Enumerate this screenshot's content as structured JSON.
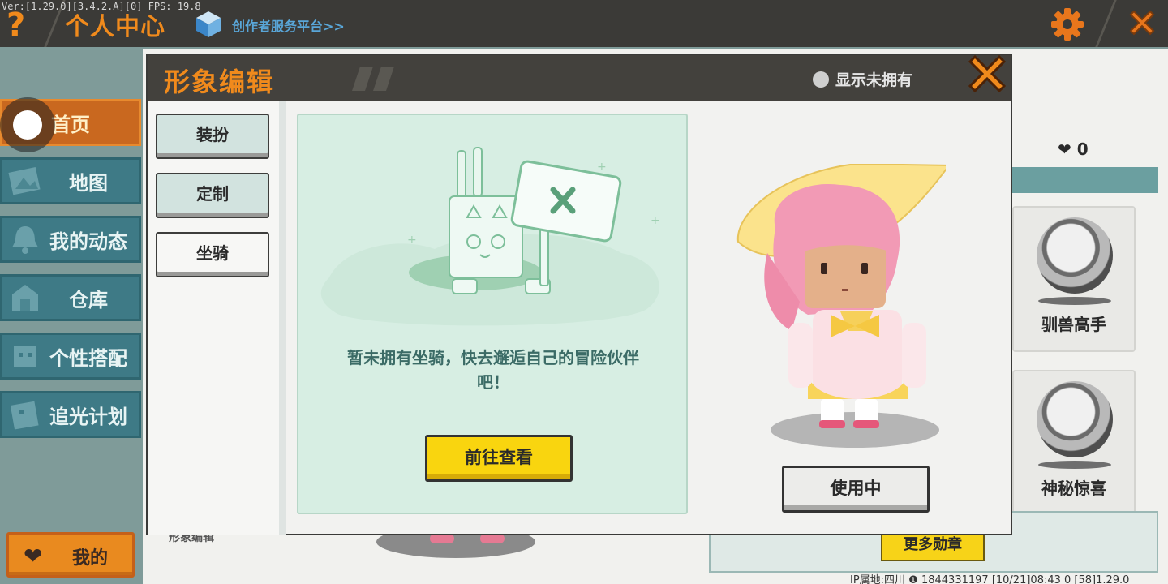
{
  "topbar": {
    "version": "Ver:[1.29.0][3.4.2.A][0] FPS: 19.8",
    "title": "个人中心",
    "creator_link": "创作者服务平台>>"
  },
  "sidebar": {
    "items": [
      {
        "label": "首页",
        "icon": "home-icon",
        "active": true
      },
      {
        "label": "地图",
        "icon": "map-icon"
      },
      {
        "label": "我的动态",
        "icon": "bell-icon"
      },
      {
        "label": "仓库",
        "icon": "warehouse-icon"
      },
      {
        "label": "个性搭配",
        "icon": "outfit-icon"
      },
      {
        "label": "追光计划",
        "icon": "plan-icon"
      }
    ],
    "my_button": "我的"
  },
  "background": {
    "likes": "0",
    "badges": [
      "驯兽高手",
      "神秘惊喜"
    ],
    "more_badges": "更多勋章",
    "edit_label": "形象编辑",
    "footer": "IP属地:四川 ❶   1844331197   [10/21]08:43 0   [58]1.29.0"
  },
  "modal": {
    "title": "形象编辑",
    "show_unowned": "显示未拥有",
    "tabs": [
      "装扮",
      "定制",
      "坐骑"
    ],
    "active_tab": "坐骑",
    "empty_message": "暂未拥有坐骑，快去邂逅自己的冒险伙伴吧！",
    "goto_button": "前往查看",
    "in_use_button": "使用中"
  },
  "colors": {
    "accent_orange": "#f08a1c",
    "sidebar_teal": "#3e7a86",
    "button_yellow": "#f9d50f",
    "empty_panel_green": "#d7eee3"
  }
}
